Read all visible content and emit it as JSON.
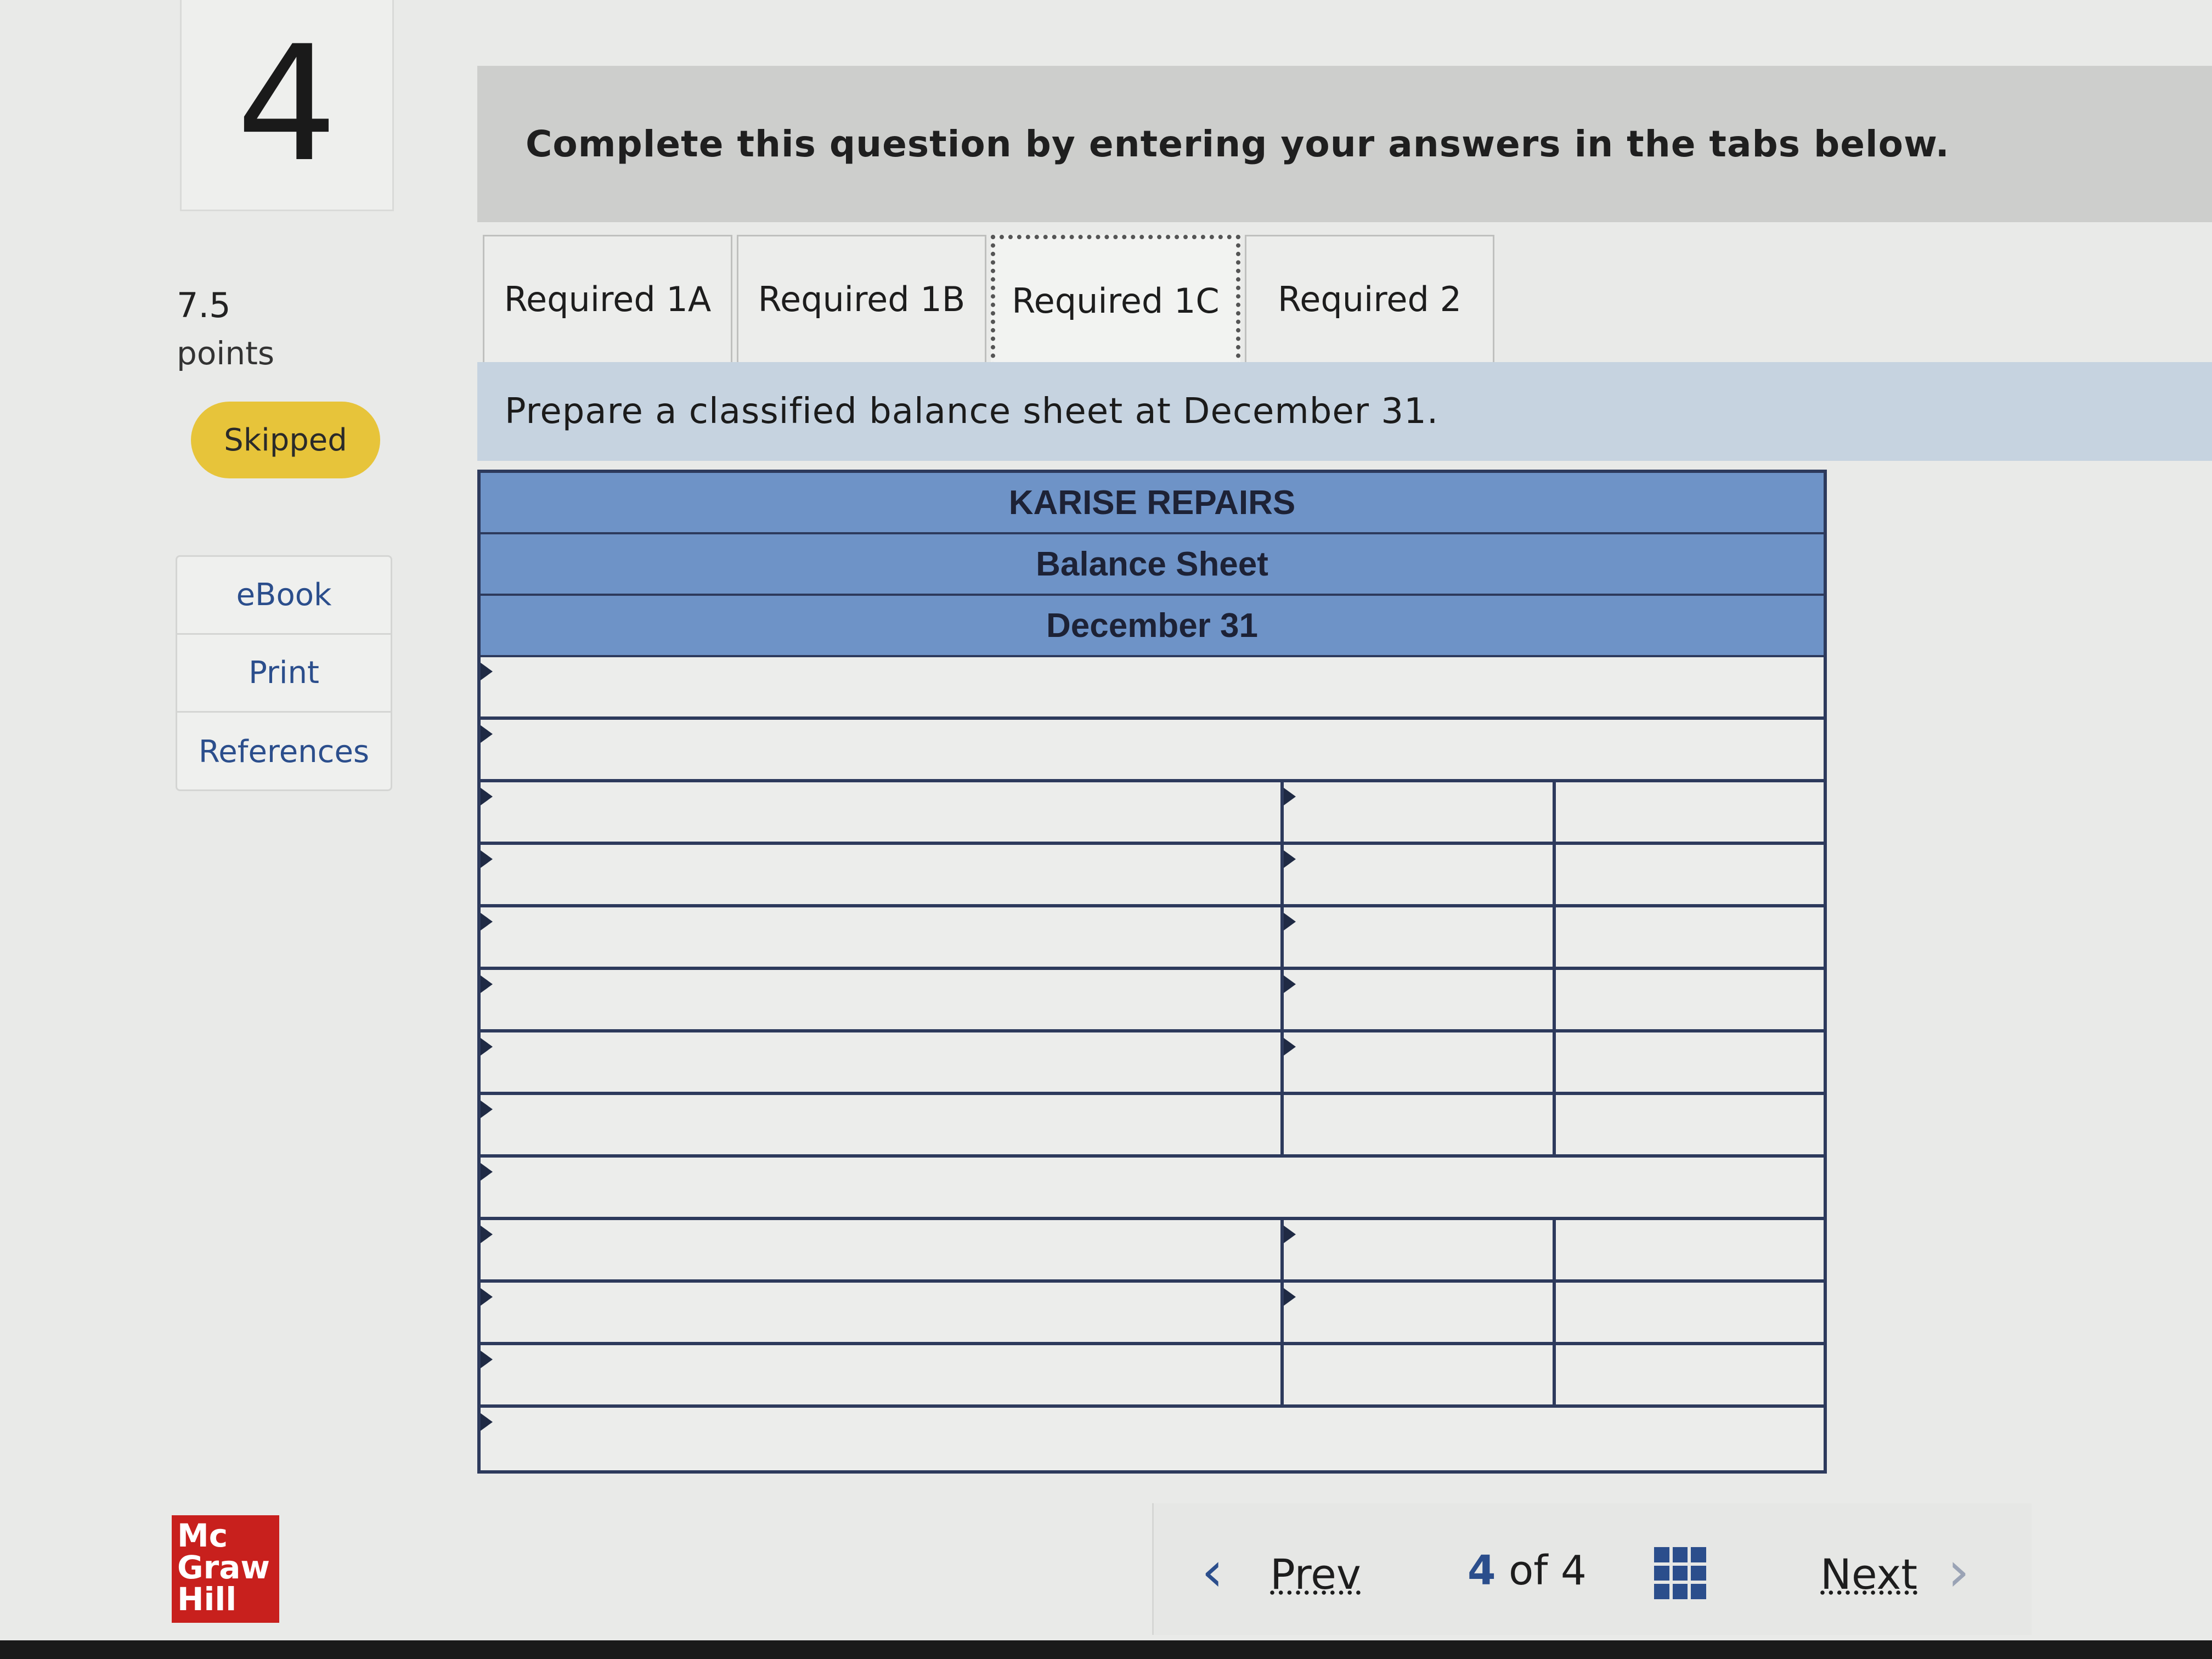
{
  "question": {
    "number": "4",
    "points_value": "7.5",
    "points_label": "points",
    "status": "Skipped"
  },
  "tools": [
    "eBook",
    "Print",
    "References"
  ],
  "logo": {
    "lines": [
      "Mc",
      "Graw",
      "Hill"
    ]
  },
  "instruction": "Complete this question by entering your answers in the tabs below.",
  "tabs": [
    {
      "label": "Required 1A",
      "active": false
    },
    {
      "label": "Required 1B",
      "active": false
    },
    {
      "label": "Required 1C",
      "active": true
    },
    {
      "label": "Required 2",
      "active": false
    }
  ],
  "prompt": "Prepare a classified balance sheet at December 31.",
  "sheet": {
    "company": "KARISE REPAIRS",
    "statement": "Balance Sheet",
    "date": "December 31",
    "rows": [
      {
        "layout": "full",
        "marker": true
      },
      {
        "layout": "full",
        "marker": true
      },
      {
        "layout": "split",
        "marker": true,
        "mid_marker": true
      },
      {
        "layout": "split",
        "marker": true,
        "mid_marker": true
      },
      {
        "layout": "split",
        "marker": true,
        "mid_marker": true
      },
      {
        "layout": "split",
        "marker": true,
        "mid_marker": true
      },
      {
        "layout": "split",
        "marker": true,
        "mid_marker": true
      },
      {
        "layout": "split",
        "marker": true,
        "mid_marker": false
      },
      {
        "layout": "full",
        "marker": true
      },
      {
        "layout": "split",
        "marker": true,
        "mid_marker": true
      },
      {
        "layout": "split",
        "marker": true,
        "mid_marker": true
      },
      {
        "layout": "split",
        "marker": true,
        "mid_marker": false
      },
      {
        "layout": "full",
        "marker": true
      }
    ]
  },
  "nav": {
    "prev_label": "Prev",
    "current": "4",
    "of_label": "of",
    "total": "4",
    "next_label": "Next"
  }
}
